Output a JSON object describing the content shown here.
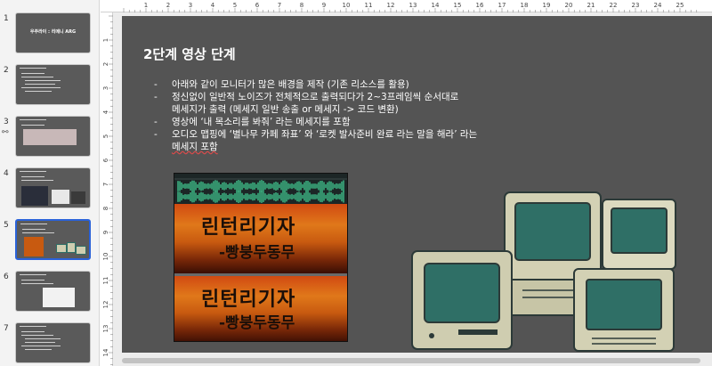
{
  "thumbnails": [
    {
      "num": "1",
      "title": "우주라이 : 리메니 ARG",
      "style": "center"
    },
    {
      "num": "2",
      "title": "",
      "style": "text"
    },
    {
      "num": "3",
      "title": "",
      "style": "image"
    },
    {
      "num": "4",
      "title": "",
      "style": "images"
    },
    {
      "num": "5",
      "title": "",
      "style": "active"
    },
    {
      "num": "6",
      "title": "",
      "style": "box"
    },
    {
      "num": "7",
      "title": "",
      "style": "text"
    }
  ],
  "ruler": {
    "top": [
      "1",
      "2",
      "3",
      "4",
      "5",
      "6",
      "7",
      "8",
      "9",
      "10",
      "11",
      "12",
      "13",
      "14",
      "15",
      "16",
      "17",
      "18",
      "19",
      "20",
      "21",
      "22",
      "23",
      "24",
      "25"
    ],
    "left": [
      "1",
      "2",
      "3",
      "4",
      "5",
      "6",
      "7",
      "8",
      "9",
      "10",
      "11",
      "12",
      "13",
      "14"
    ]
  },
  "slide": {
    "title": "2단계 영상 단계",
    "bullets": [
      {
        "dash": "-",
        "lines": [
          "아래와 같이 모니터가 많은 배경을 제작 (기존 리소스를 활용)"
        ]
      },
      {
        "dash": "-",
        "lines": [
          "정신없이 일반적 노이즈가 전체적으로 출력되다가 2~3프레임씩 순서대로",
          "메세지가 출력 (메세지 일반 송출 or 메세지 -> 코드 변환)"
        ]
      },
      {
        "dash": "-",
        "lines": [
          "영상에 ‘내 목소리를 봐줘’ 라는 메세지를 포함"
        ]
      },
      {
        "dash": "-",
        "lines": [
          "오디오 맵핑에 ‘별나무 카페 좌표’ 와 ‘로켓 발사준비 완료 라는 말을 해라’ 라는",
          "메세지 포함"
        ]
      }
    ],
    "spectrogram": {
      "line1": "린턴리기자",
      "line2": "-빵붕두동무"
    }
  },
  "colors": {
    "slide_bg": "#545454",
    "canvas_bg": "#ececec",
    "active_thumb": "#2a62d9",
    "monitor_body": "#cfcdb0",
    "monitor_screen": "#2f6f66"
  }
}
